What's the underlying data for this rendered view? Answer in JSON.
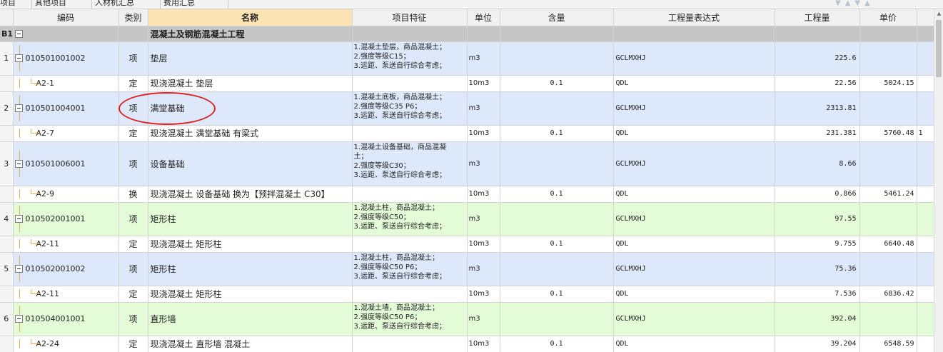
{
  "tabs": [
    "项目",
    "其他项目",
    "人材机汇总",
    "费用汇总"
  ],
  "columns": {
    "rownum": "",
    "code": "编码",
    "type": "类别",
    "name": "名称",
    "feature": "项目特征",
    "unit": "单位",
    "content": "含量",
    "expr": "工程量表达式",
    "amount": "工程量",
    "price": "单价"
  },
  "group": {
    "rownum": "B1",
    "name": "混凝土及钢筋混凝土工程"
  },
  "rows": [
    {
      "rownum": "1",
      "code": "010501001002",
      "type": "项",
      "name": "垫层",
      "feature": [
        "1.混凝土垫层，商品混凝土；",
        "2.强度等级C15；",
        "3.运距、泵送自行综合考虑；"
      ],
      "unit": "m3",
      "content": "",
      "expr": "GCLMXHJ",
      "amount": "225.6",
      "price": "",
      "extra": "",
      "color": "blue"
    },
    {
      "rownum": "",
      "code": "A2-1",
      "type": "定",
      "name": "现浇混凝土 垫层",
      "feature": [],
      "unit": "10m3",
      "content": "0.1",
      "expr": "QDL",
      "amount": "22.56",
      "price": "5024.15",
      "extra": "",
      "color": "sub"
    },
    {
      "rownum": "2",
      "code": "010501004001",
      "type": "项",
      "name": "满堂基础",
      "feature": [
        "1.混凝土底板，商品混凝土；",
        "2.强度等级C35 P6；",
        "3.运距、泵送自行综合考虑；"
      ],
      "unit": "m3",
      "content": "",
      "expr": "GCLMXHJ",
      "amount": "2313.81",
      "price": "",
      "extra": "",
      "color": "blue"
    },
    {
      "rownum": "",
      "code": "A2-7",
      "type": "定",
      "name": "现浇混凝土 满堂基础 有梁式",
      "feature": [],
      "unit": "10m3",
      "content": "0.1",
      "expr": "QDL",
      "amount": "231.381",
      "price": "5760.48",
      "extra": "1",
      "color": "sub"
    },
    {
      "rownum": "3",
      "code": "010501006001",
      "type": "项",
      "name": "设备基础",
      "feature": [
        "1.混凝土设备基础，商品混凝",
        "土；",
        "2.强度等级C30；",
        "3.运距、泵送自行综合考虑；"
      ],
      "unit": "m3",
      "content": "",
      "expr": "GCLMXHJ",
      "amount": "8.66",
      "price": "",
      "extra": "",
      "color": "blue"
    },
    {
      "rownum": "",
      "code": "A2-9",
      "type": "换",
      "name": "现浇混凝土 设备基础  换为【预拌混凝土 C30】",
      "feature": [],
      "unit": "10m3",
      "content": "0.1",
      "expr": "QDL",
      "amount": "0.866",
      "price": "5461.24",
      "extra": "",
      "color": "sub"
    },
    {
      "rownum": "4",
      "code": "010502001001",
      "type": "项",
      "name": "矩形柱",
      "feature": [
        "1.混凝土柱，商品混凝土；",
        "2.强度等级C50；",
        "3.运距、泵送自行综合考虑；"
      ],
      "unit": "m3",
      "content": "",
      "expr": "GCLMXHJ",
      "amount": "97.55",
      "price": "",
      "extra": "",
      "color": "green"
    },
    {
      "rownum": "",
      "code": "A2-11",
      "type": "定",
      "name": "现浇混凝土 矩形柱",
      "feature": [],
      "unit": "10m3",
      "content": "0.1",
      "expr": "QDL",
      "amount": "9.755",
      "price": "6640.48",
      "extra": "",
      "color": "sub"
    },
    {
      "rownum": "5",
      "code": "010502001002",
      "type": "项",
      "name": "矩形柱",
      "feature": [
        "1.混凝土柱，商品混凝土；",
        "2.强度等级C50 P6；",
        "3.运距、泵送自行综合考虑；"
      ],
      "unit": "m3",
      "content": "",
      "expr": "GCLMXHJ",
      "amount": "75.36",
      "price": "",
      "extra": "",
      "color": "blue"
    },
    {
      "rownum": "",
      "code": "A2-11",
      "type": "定",
      "name": "现浇混凝土 矩形柱",
      "feature": [],
      "unit": "10m3",
      "content": "0.1",
      "expr": "QDL",
      "amount": "7.536",
      "price": "6836.42",
      "extra": "",
      "color": "sub"
    },
    {
      "rownum": "6",
      "code": "010504001001",
      "type": "项",
      "name": "直形墙",
      "feature": [
        "1.混凝土墙，商品混凝土；",
        "2.强度等级C50 P6；",
        "3.运距、泵送自行综合考虑；"
      ],
      "unit": "m3",
      "content": "",
      "expr": "GCLMXHJ",
      "amount": "392.04",
      "price": "",
      "extra": "",
      "color": "green"
    },
    {
      "rownum": "",
      "code": "A2-24",
      "type": "定",
      "name": "现浇混凝土 直形墙 混凝土",
      "feature": [],
      "unit": "10m3",
      "content": "0.1",
      "expr": "QDL",
      "amount": "39.204",
      "price": "6548.59",
      "extra": "",
      "color": "sub"
    }
  ]
}
